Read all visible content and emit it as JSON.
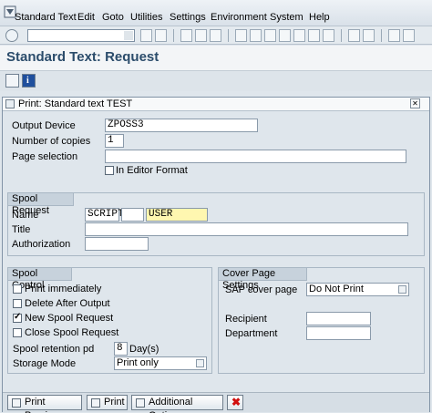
{
  "menu": {
    "items": [
      "Standard Text",
      "Edit",
      "Goto",
      "Utilities",
      "Settings",
      "Environment",
      "System",
      "Help"
    ]
  },
  "title": "Standard Text: Request",
  "dialog": {
    "title": "Print: Standard text TEST",
    "output_device_label": "Output Device",
    "output_device_value": "ZPOSS3",
    "copies_label": "Number of copies",
    "copies_value": "1",
    "page_selection_label": "Page selection",
    "page_selection_value": "",
    "in_editor_label": "In Editor Format",
    "in_editor_checked": false
  },
  "spool_request": {
    "title": "Spool Request",
    "name_label": "Name",
    "name_values": [
      "SCRIPT",
      "",
      "USER"
    ],
    "title_label": "Title",
    "title_value": "",
    "authorization_label": "Authorization",
    "authorization_value": ""
  },
  "spool_control": {
    "title": "Spool Control",
    "checkboxes": [
      {
        "label": "Print immediately",
        "checked": false
      },
      {
        "label": "Delete After Output",
        "checked": false
      },
      {
        "label": "New Spool Request",
        "checked": true
      },
      {
        "label": "Close Spool Request",
        "checked": false
      }
    ],
    "retention_label": "Spool retention pd",
    "retention_value": "8",
    "retention_unit": "Day(s)",
    "storage_label": "Storage Mode",
    "storage_value": "Print only"
  },
  "cover_page": {
    "title": "Cover Page Settings",
    "sap_cover_label": "SAP cover page",
    "sap_cover_value": "Do Not Print",
    "recipient_label": "Recipient",
    "recipient_value": "",
    "department_label": "Department",
    "department_value": ""
  },
  "buttons": {
    "print_preview": "Print Preview",
    "print": "Print",
    "additional_options": "Additional Options"
  }
}
